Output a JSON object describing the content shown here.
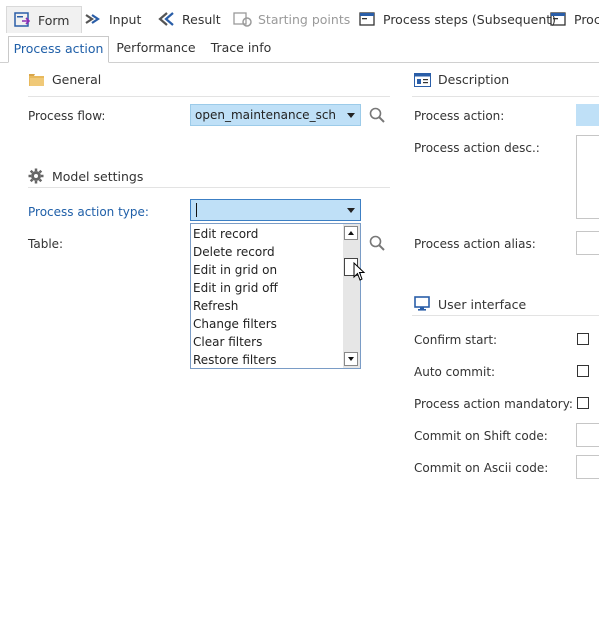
{
  "top_tabs": [
    {
      "label": "Form"
    },
    {
      "label": "Input"
    },
    {
      "label": "Result"
    },
    {
      "label": "Starting points"
    },
    {
      "label": "Process steps (Subsequent)"
    },
    {
      "label": "Proc"
    }
  ],
  "sub_tabs": [
    {
      "label": "Process action"
    },
    {
      "label": "Performance"
    },
    {
      "label": "Trace info"
    }
  ],
  "general": {
    "title": "General",
    "process_flow_label": "Process flow:",
    "process_flow_value": "open_maintenance_sched"
  },
  "model_settings": {
    "title": "Model settings",
    "process_action_type_label": "Process action type:",
    "process_action_type_value": "",
    "table_label": "Table:"
  },
  "dropdown": {
    "options": [
      "Edit record",
      "Delete record",
      "Edit in grid on",
      "Edit in grid off",
      "Refresh",
      "Change filters",
      "Clear filters",
      "Restore filters"
    ]
  },
  "description": {
    "title": "Description",
    "process_action_label": "Process action:",
    "process_action_desc_label": "Process action desc.:",
    "process_action_alias_label": "Process action alias:"
  },
  "user_interface": {
    "title": "User interface",
    "confirm_start_label": "Confirm start:",
    "auto_commit_label": "Auto commit:",
    "process_action_mandatory_label": "Process action mandatory:",
    "commit_shift_label": "Commit on Shift code:",
    "commit_ascii_label": "Commit on Ascii code:"
  }
}
